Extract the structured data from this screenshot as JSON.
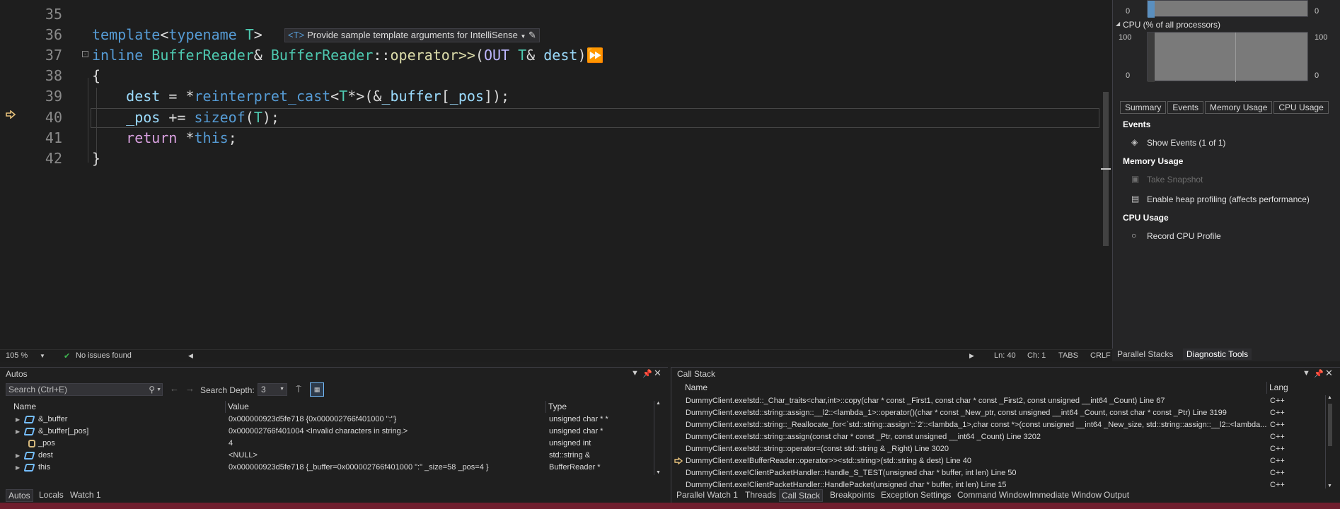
{
  "editor": {
    "lines": [
      {
        "num": "35"
      },
      {
        "num": "36"
      },
      {
        "num": "37"
      },
      {
        "num": "38"
      },
      {
        "num": "39"
      },
      {
        "num": "40"
      },
      {
        "num": "41"
      },
      {
        "num": "42"
      }
    ],
    "hint_tag": "<T>",
    "hint_text": "Provide sample template arguments for IntelliSense",
    "zoom": "105 %",
    "issues": "No issues found",
    "ln": "Ln: 40",
    "ch": "Ch: 1",
    "tabs": "TABS",
    "eol": "CRLF"
  },
  "diag": {
    "cpu_label": "CPU (% of all processors)",
    "axis_100": "100",
    "axis_0": "0",
    "tabs": [
      "Summary",
      "Events",
      "Memory Usage",
      "CPU Usage"
    ],
    "events_h": "Events",
    "show_events": "Show Events (1 of 1)",
    "memory_h": "Memory Usage",
    "take_snapshot": "Take Snapshot",
    "heap_profiling": "Enable heap profiling (affects performance)",
    "cpu_h": "CPU Usage",
    "record_cpu": "Record CPU Profile",
    "bottom_tab1": "Parallel Stacks",
    "bottom_tab2": "Diagnostic Tools"
  },
  "autos": {
    "title": "Autos",
    "search_placeholder": "Search (Ctrl+E)",
    "search_depth_label": "Search Depth:",
    "search_depth_value": "3",
    "col_name": "Name",
    "col_value": "Value",
    "col_type": "Type",
    "rows": [
      {
        "name": "&_buffer",
        "value": "0x000000923d5fe718 {0x000002766f401000 \":\"}",
        "type": "unsigned char * *"
      },
      {
        "name": "&_buffer[_pos]",
        "value": "0x000002766f401004  <Invalid characters in string.>",
        "type": "unsigned char *"
      },
      {
        "name": "_pos",
        "value": "4",
        "type": "unsigned int"
      },
      {
        "name": "dest",
        "value": "<NULL>",
        "type": "std::string &"
      },
      {
        "name": "this",
        "value": "0x000000923d5fe718 {_buffer=0x000002766f401000 \":\" _size=58 _pos=4 }",
        "type": "BufferReader *"
      }
    ],
    "tabs": [
      "Autos",
      "Locals",
      "Watch 1"
    ]
  },
  "callstack": {
    "title": "Call Stack",
    "col_name": "Name",
    "col_lang": "Lang",
    "rows": [
      {
        "name": "DummyClient.exe!std::_Char_traits<char,int>::copy(char * const _First1, const char * const _First2, const unsigned __int64 _Count) Line 67",
        "lang": "C++"
      },
      {
        "name": "DummyClient.exe!std::string::assign::__l2::<lambda_1>::operator()(char * const _New_ptr, const unsigned __int64 _Count, const char * const _Ptr) Line 3199",
        "lang": "C++"
      },
      {
        "name": "DummyClient.exe!std::string::_Reallocate_for<`std::string::assign'::`2'::<lambda_1>,char const *>(const unsigned __int64 _New_size, std::string::assign::__l2::<lambda...",
        "lang": "C++"
      },
      {
        "name": "DummyClient.exe!std::string::assign(const char * const _Ptr, const unsigned __int64 _Count) Line 3202",
        "lang": "C++"
      },
      {
        "name": "DummyClient.exe!std::string::operator=(const std::string & _Right) Line 3020",
        "lang": "C++"
      },
      {
        "name": "DummyClient.exe!BufferReader::operator>><std::string>(std::string & dest) Line 40",
        "lang": "C++"
      },
      {
        "name": "DummyClient.exe!ClientPacketHandler::Handle_S_TEST(unsigned char * buffer, int len) Line 50",
        "lang": "C++"
      },
      {
        "name": "DummyClient.exe!ClientPacketHandler::HandlePacket(unsigned char * buffer, int len) Line 15",
        "lang": "C++"
      }
    ],
    "tabs": [
      "Parallel Watch 1",
      "Threads",
      "Call Stack",
      "Breakpoints",
      "Exception Settings",
      "Command Window",
      "Immediate Window",
      "Output"
    ]
  }
}
